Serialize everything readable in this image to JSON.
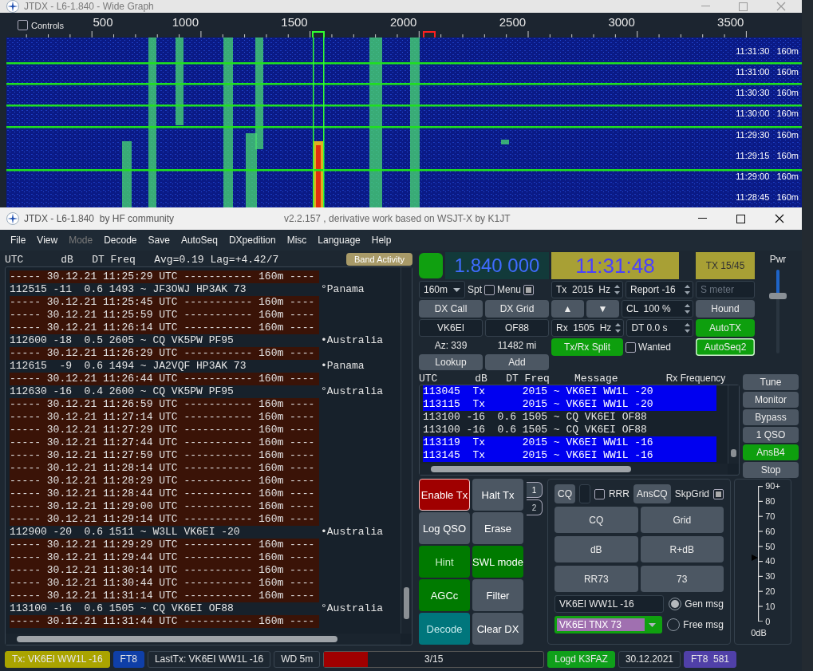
{
  "wide_graph": {
    "title": "JTDX - L6-1.840 - Wide Graph",
    "controls": {
      "label": "Controls",
      "checked": false
    },
    "scale_labels": [
      "500",
      "1000",
      "1500",
      "2000",
      "2500",
      "3000",
      "3500"
    ],
    "waterfall_rows": [
      {
        "time": "11:31:30",
        "band": "160m"
      },
      {
        "time": "11:31:00",
        "band": "160m"
      },
      {
        "time": "11:30:30",
        "band": "160m"
      },
      {
        "time": "11:30:00",
        "band": "160m"
      },
      {
        "time": "11:29:30",
        "band": "160m"
      },
      {
        "time": "11:29:15",
        "band": "160m"
      },
      {
        "time": "11:29:00",
        "band": "160m"
      },
      {
        "time": "11:28:45",
        "band": "160m"
      }
    ]
  },
  "main_window": {
    "title": "JTDX - L6-1.840  by HF community",
    "version": "v2.2.157 , derivative work based on WSJT-X by K1JT"
  },
  "menu": [
    {
      "label": "File",
      "disabled": false
    },
    {
      "label": "View",
      "disabled": false
    },
    {
      "label": "Mode",
      "disabled": true
    },
    {
      "label": "Decode",
      "disabled": false
    },
    {
      "label": "Save",
      "disabled": false
    },
    {
      "label": "AutoSeq",
      "disabled": false
    },
    {
      "label": "DXpedition",
      "disabled": false
    },
    {
      "label": "Misc",
      "disabled": false
    },
    {
      "label": "Language",
      "disabled": false
    },
    {
      "label": "Help",
      "disabled": false
    }
  ],
  "band_activity": {
    "header": "UTC      dB   DT Freq   Avg=0.19 Lag=+4.42/7",
    "button": "Band Activity",
    "rows": [
      {
        "kind": "separator",
        "text": "----- 30.12.21 11:25:29 UTC ----------- 160m ----"
      },
      {
        "kind": "decode",
        "text": "112515 -11  0.6 1493 ~ JF3OWJ HP3AK 73",
        "country": "°Panama"
      },
      {
        "kind": "separator",
        "text": "----- 30.12.21 11:25:45 UTC ----------- 160m ----"
      },
      {
        "kind": "separator",
        "text": "----- 30.12.21 11:25:59 UTC ----------- 160m ----"
      },
      {
        "kind": "separator",
        "text": "----- 30.12.21 11:26:14 UTC ----------- 160m ----"
      },
      {
        "kind": "decode",
        "text": "112600 -18  0.5 2605 ~ CQ VK5PW PF95",
        "country": "•Australia"
      },
      {
        "kind": "separator",
        "text": "----- 30.12.21 11:26:29 UTC ----------- 160m ----"
      },
      {
        "kind": "decode",
        "text": "112615  -9  0.6 1494 ~ JA2VQF HP3AK 73",
        "country": "•Panama"
      },
      {
        "kind": "separator",
        "text": "----- 30.12.21 11:26:44 UTC ----------- 160m ----"
      },
      {
        "kind": "decode",
        "text": "112630 -16  0.4 2600 ~ CQ VK5PW PF95",
        "country": "°Australia"
      },
      {
        "kind": "separator",
        "text": "----- 30.12.21 11:26:59 UTC ----------- 160m ----"
      },
      {
        "kind": "separator",
        "text": "----- 30.12.21 11:27:14 UTC ----------- 160m ----"
      },
      {
        "kind": "separator",
        "text": "----- 30.12.21 11:27:29 UTC ----------- 160m ----"
      },
      {
        "kind": "separator",
        "text": "----- 30.12.21 11:27:44 UTC ----------- 160m ----"
      },
      {
        "kind": "separator",
        "text": "----- 30.12.21 11:27:59 UTC ----------- 160m ----"
      },
      {
        "kind": "separator",
        "text": "----- 30.12.21 11:28:14 UTC ----------- 160m ----"
      },
      {
        "kind": "separator",
        "text": "----- 30.12.21 11:28:29 UTC ----------- 160m ----"
      },
      {
        "kind": "separator",
        "text": "----- 30.12.21 11:28:44 UTC ----------- 160m ----"
      },
      {
        "kind": "separator",
        "text": "----- 30.12.21 11:29:00 UTC ----------- 160m ----"
      },
      {
        "kind": "separator",
        "text": "----- 30.12.21 11:29:14 UTC ----------- 160m ----"
      },
      {
        "kind": "decode",
        "text": "112900 -20  0.6 1511 ~ W3LL VK6EI -20",
        "country": "•Australia"
      },
      {
        "kind": "separator",
        "text": "----- 30.12.21 11:29:29 UTC ----------- 160m ----"
      },
      {
        "kind": "separator",
        "text": "----- 30.12.21 11:29:44 UTC ----------- 160m ----"
      },
      {
        "kind": "separator",
        "text": "----- 30.12.21 11:30:14 UTC ----------- 160m ----"
      },
      {
        "kind": "separator",
        "text": "----- 30.12.21 11:30:44 UTC ----------- 160m ----"
      },
      {
        "kind": "separator",
        "text": "----- 30.12.21 11:31:14 UTC ----------- 160m ----"
      },
      {
        "kind": "decode",
        "text": "113100 -16  0.6 1505 ~ CQ VK6EI OF88",
        "country": "°Australia"
      },
      {
        "kind": "separator",
        "text": "----- 30.12.21 11:31:44 UTC ----------- 160m ----"
      }
    ]
  },
  "controls": {
    "frequency": "1.840 000",
    "clock": "11:31:48",
    "tx_period": "TX 15/45",
    "band": "160m",
    "spot": {
      "label": "Spt",
      "checked": false
    },
    "menu_toggle": {
      "label": "Menu",
      "checked": true
    },
    "tx_freq": "Tx  2015  Hz",
    "report": "Report -16",
    "s_meter": {
      "placeholder": "S meter"
    },
    "dx_call_button": "DX Call",
    "dx_grid_button": "DX Grid",
    "up": "▲",
    "down": "▼",
    "cl": "CL  100 %",
    "hound": "Hound",
    "dx_call": "VK6EI",
    "dx_grid": "OF88",
    "rx_freq": "Rx  1505  Hz",
    "dt": "DT 0.0 s",
    "autotx": {
      "label": "AutoTX",
      "on": true
    },
    "azimuth": "Az: 339",
    "distance": "11482 mi",
    "split": {
      "label": "Tx/Rx Split",
      "on": true
    },
    "wanted": {
      "label": "Wanted",
      "checked": false
    },
    "autoseq": {
      "label": "AutoSeq2",
      "on": true
    },
    "lookup": "Lookup",
    "add": "Add",
    "pwr": {
      "label": "Pwr",
      "level": 0.7
    }
  },
  "rx_frequency": {
    "header": "UTC      dB   DT Freq    Message",
    "title": "Rx Frequency",
    "rows": [
      {
        "kind": "tx",
        "text": "113045  Tx      2015 ~ VK6EI WW1L -20"
      },
      {
        "kind": "tx",
        "text": "113115  Tx      2015 ~ VK6EI WW1L -20"
      },
      {
        "kind": "rx",
        "text": "113100 -16  0.6 1505 ~ CQ VK6EI OF88"
      },
      {
        "kind": "rx",
        "text": "113100 -16  0.6 1505 ~ CQ VK6EI OF88"
      },
      {
        "kind": "tx",
        "text": "113119  Tx      2015 ~ VK6EI WW1L -16"
      },
      {
        "kind": "tx",
        "text": "113145  Tx      2015 ~ VK6EI WW1L -16"
      }
    ]
  },
  "side_buttons": [
    {
      "label": "Tune",
      "on": false
    },
    {
      "label": "Monitor",
      "on": false
    },
    {
      "label": "Bypass",
      "on": false
    },
    {
      "label": "1 QSO",
      "on": false
    },
    {
      "label": "AnsB4",
      "on": true
    },
    {
      "label": "Stop",
      "on": false
    }
  ],
  "action_buttons": [
    {
      "label": "Enable Tx",
      "kind": "alert",
      "disabled": false
    },
    {
      "label": "Halt Tx",
      "kind": "plain",
      "disabled": false
    },
    {
      "label": "Log QSO",
      "kind": "plain",
      "disabled": false
    },
    {
      "label": "Erase",
      "kind": "plain",
      "disabled": false
    },
    {
      "label": "Hint",
      "kind": "active",
      "disabled": true
    },
    {
      "label": "SWL mode",
      "kind": "active",
      "disabled": false
    },
    {
      "label": "AGCc",
      "kind": "active",
      "disabled": false
    },
    {
      "label": "Filter",
      "kind": "plain",
      "disabled": false
    },
    {
      "label": "Decode",
      "kind": "decoding",
      "disabled": true
    },
    {
      "label": "Clear DX",
      "kind": "plain",
      "disabled": false
    }
  ],
  "tabs": [
    {
      "label": "1",
      "selected": true
    },
    {
      "label": "2",
      "selected": false
    }
  ],
  "messages": {
    "cq_button": "CQ",
    "rrr": {
      "label": "RRR",
      "checked": false
    },
    "anscq": "AnsCQ",
    "skpgrid": {
      "label": "SkpGrid",
      "checked": true
    },
    "macros": [
      "CQ",
      "Grid",
      "dB",
      "R+dB",
      "RR73",
      "73"
    ],
    "gen_message": "VK6EI WW1L -16",
    "free_message": "VK6EI TNX 73",
    "modes": [
      {
        "label": "Gen msg",
        "selected": true
      },
      {
        "label": "Free msg",
        "selected": false
      }
    ]
  },
  "meter": {
    "scale": [
      "90+",
      "80",
      "70",
      "60",
      "50",
      "40",
      "30",
      "20",
      "10",
      "0"
    ],
    "level": 0.47,
    "reading": "0dB"
  },
  "status_bar": {
    "left": [
      {
        "text": "Tx: VK6EI WW1L -16",
        "color": "#aaa400"
      },
      {
        "text": "FT8",
        "color": "#0f3fa8"
      },
      {
        "text": "LastTx: VK6EI WW1L -16"
      },
      {
        "text": "WD 5m"
      }
    ],
    "progress": {
      "label": "3/15",
      "level": 0.2
    },
    "right": [
      {
        "text": "Logd K3FAZ",
        "color": "#0fa01a"
      },
      {
        "text": "30.12.2021"
      },
      {
        "text": "FT8  581",
        "color": "#5040a8"
      }
    ]
  }
}
